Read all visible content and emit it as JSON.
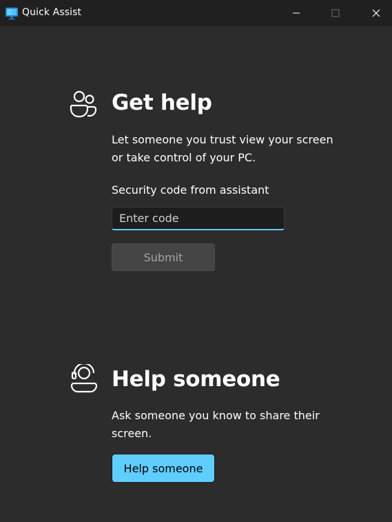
{
  "window": {
    "title": "Quick Assist",
    "controls": {
      "minimize": "minimize",
      "maximize": "maximize",
      "close": "close"
    }
  },
  "get_help": {
    "heading": "Get help",
    "description": "Let someone you trust view your screen or take control of your PC.",
    "field_label": "Security code from assistant",
    "input_placeholder": "Enter code",
    "input_value": "",
    "submit_label": "Submit",
    "icon": "people-icon"
  },
  "help_someone": {
    "heading": "Help someone",
    "description": "Ask someone you know to share their screen.",
    "button_label": "Help someone",
    "icon": "person-headset-icon"
  },
  "colors": {
    "background": "#2c2c2c",
    "titlebar": "#202020",
    "accent": "#60cdff",
    "disabled_button": "#454545"
  }
}
